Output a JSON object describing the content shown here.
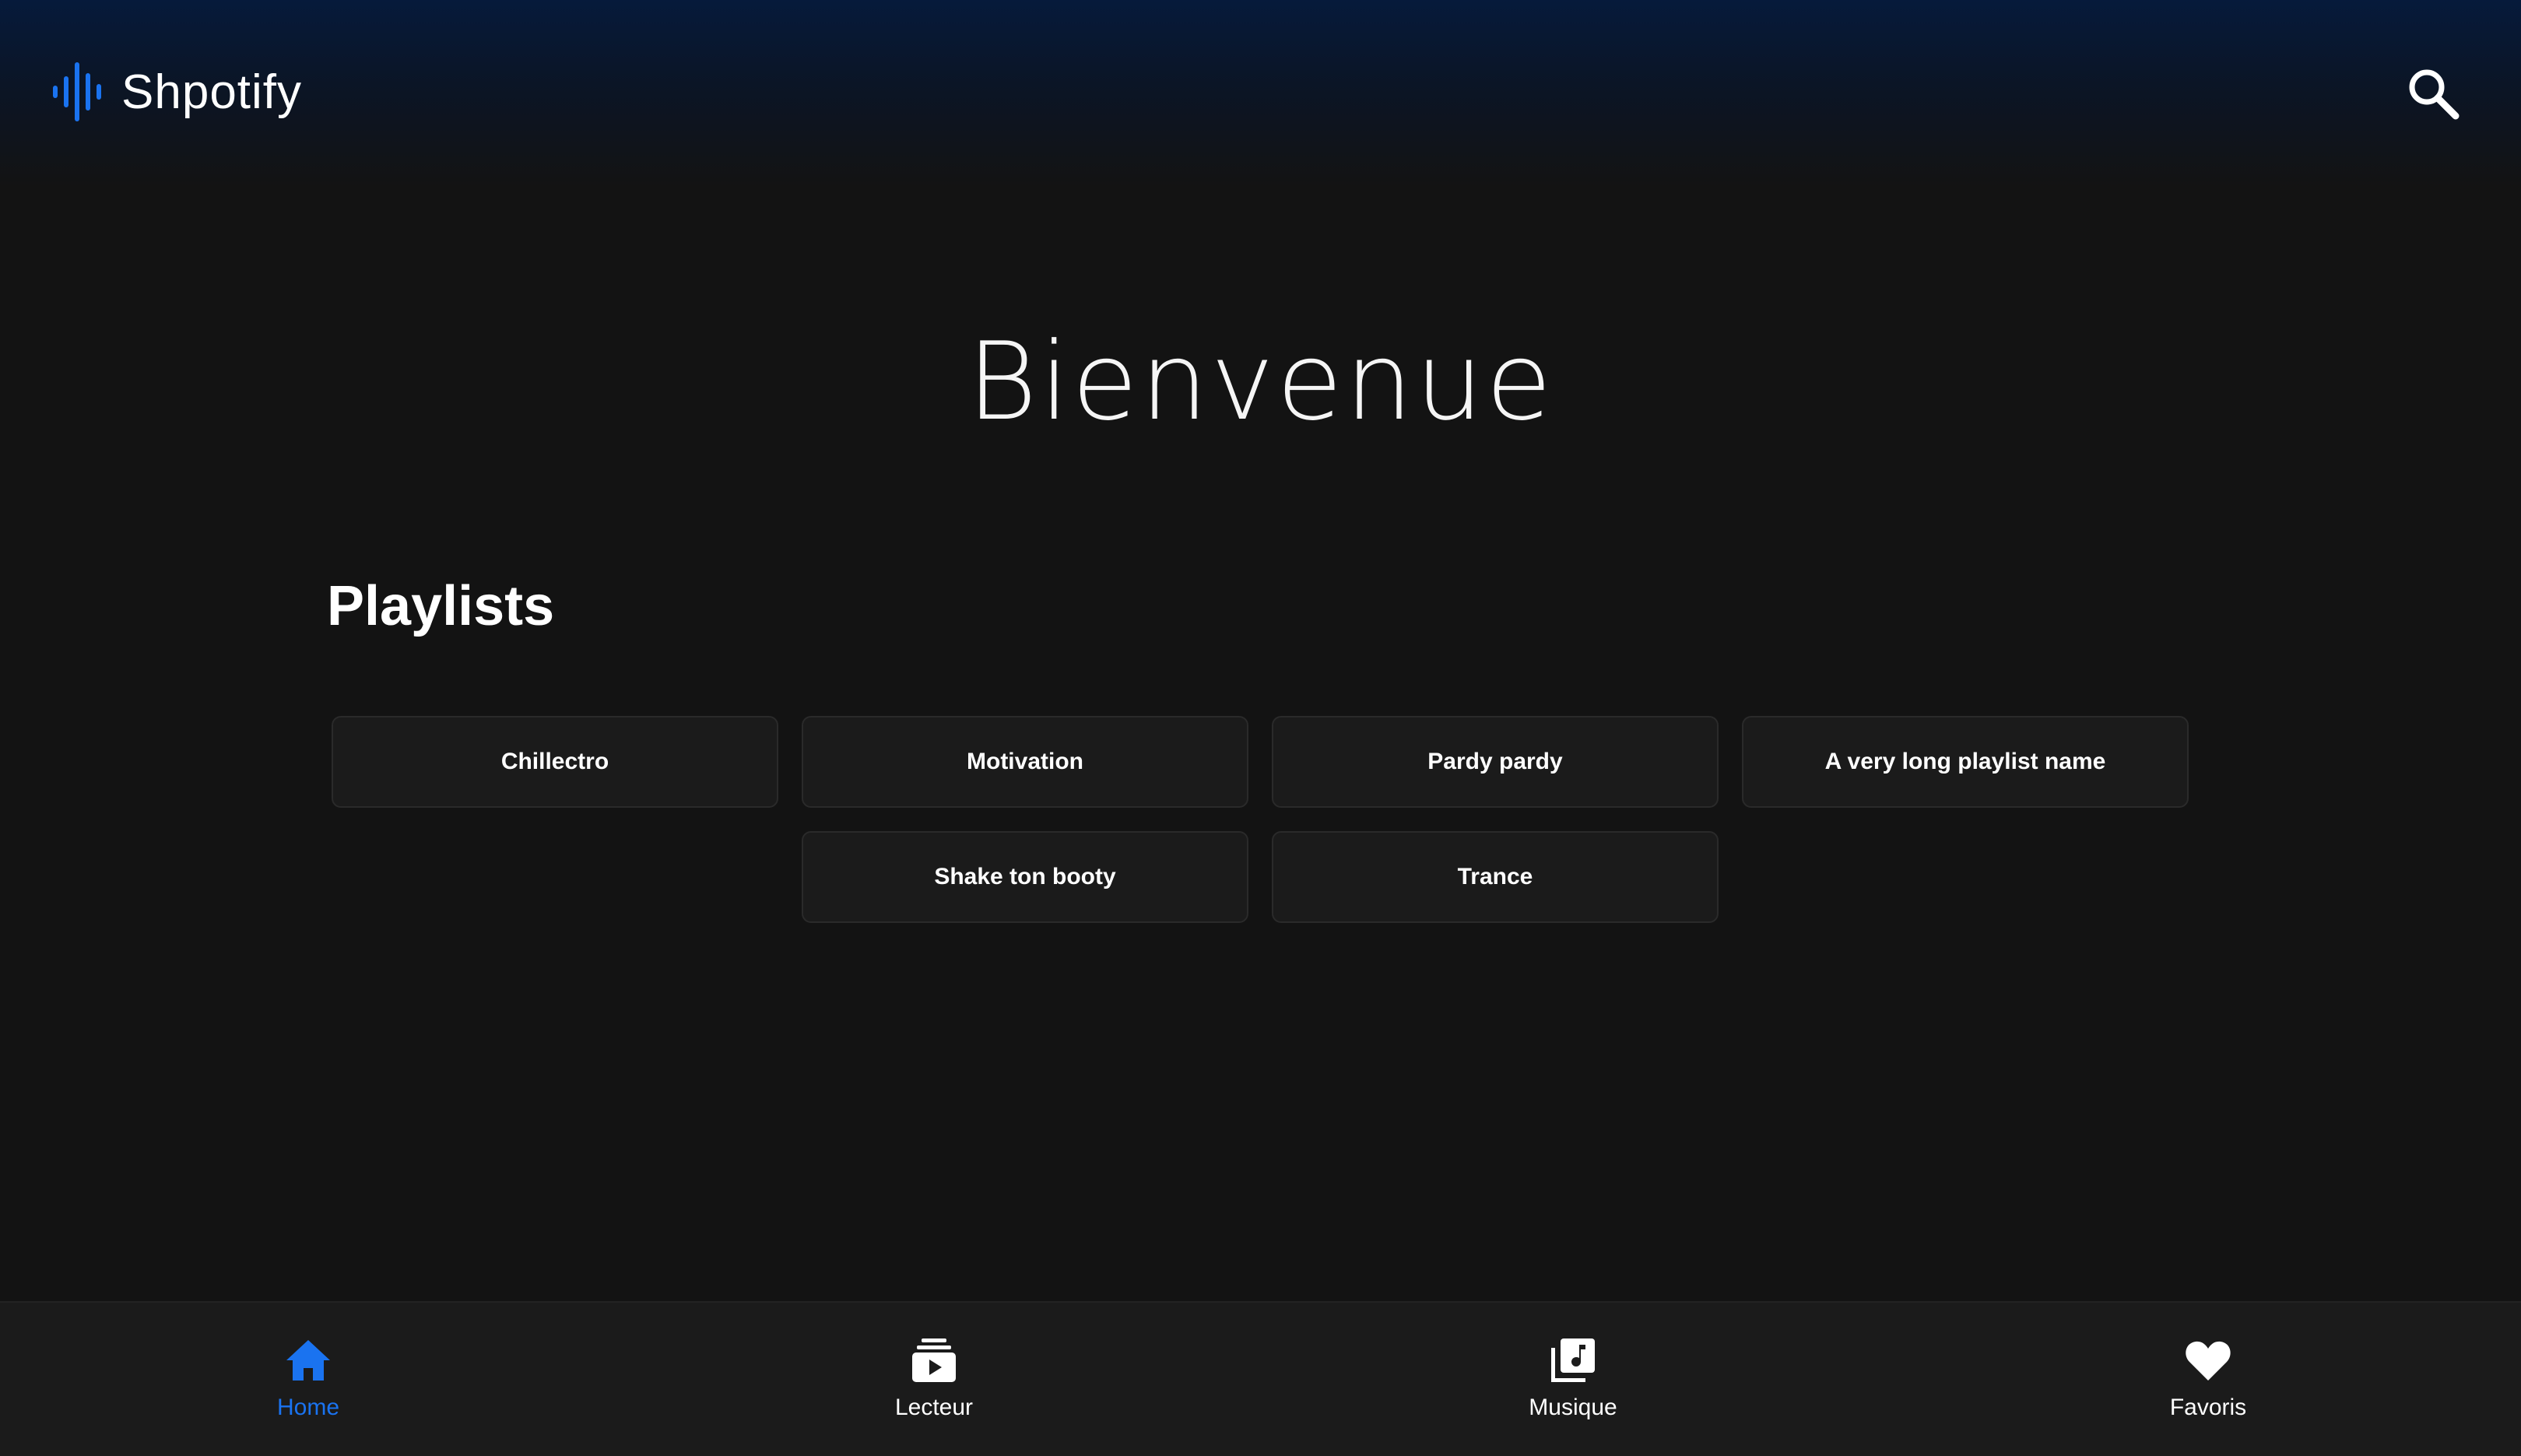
{
  "app": {
    "name": "Shpotify",
    "logo_icon": "waveform-icon",
    "accent_color": "#1a73f0"
  },
  "header": {
    "search_icon": "search-icon"
  },
  "main": {
    "welcome": "Bienvenue",
    "playlists_title": "Playlists",
    "playlists": [
      "Chillectro",
      "Motivation",
      "Pardy pardy",
      "A very long playlist name",
      "Shake ton booty",
      "Trance"
    ]
  },
  "bottom_nav": {
    "items": [
      {
        "label": "Home",
        "icon": "home-icon",
        "active": true
      },
      {
        "label": "Lecteur",
        "icon": "play-queue-icon",
        "active": false
      },
      {
        "label": "Musique",
        "icon": "music-library-icon",
        "active": false
      },
      {
        "label": "Favoris",
        "icon": "heart-icon",
        "active": false
      }
    ]
  }
}
